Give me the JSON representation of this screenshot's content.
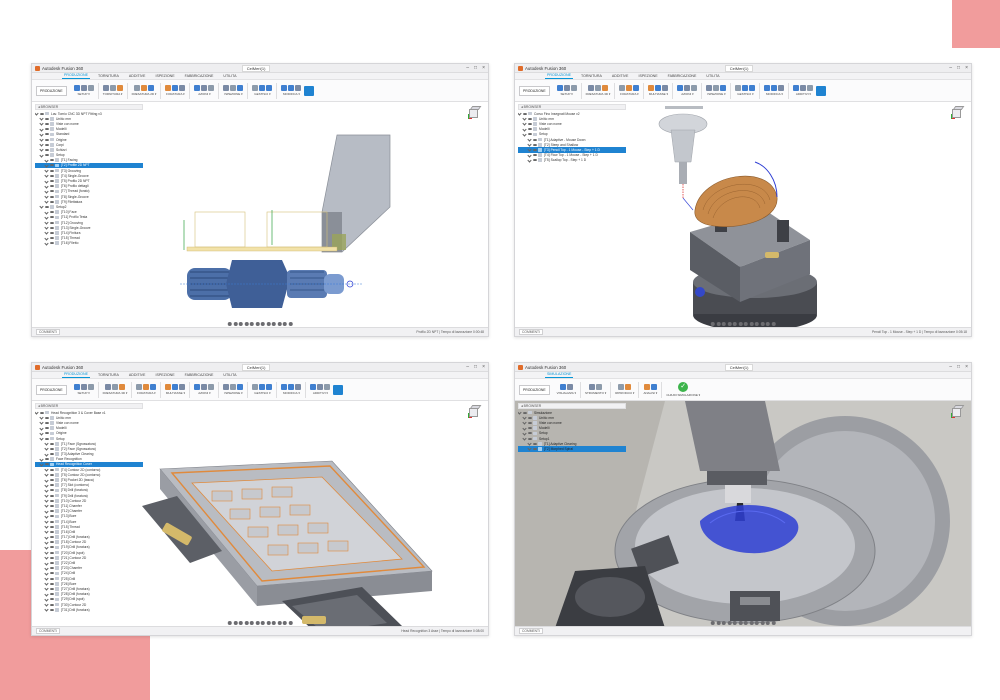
{
  "colors": {
    "accent": "#1f83d1",
    "decoration": "#f19c9c",
    "part_orange": "#e08a3c",
    "toolpath_blue": "#2e3ed4"
  },
  "windows": [
    {
      "app_title": "Autodesk Fusion 360",
      "document_tab": "CelMeri(1)",
      "tabs": [
        "PRODUZIONE",
        "TORNITURA",
        "ADDITIVE",
        "ISPEZIONE",
        "FABBRICAZIONE",
        "UTILITA"
      ],
      "workspace": "PRODUZIONE",
      "ribbon_groups": [
        "SETUP",
        "TORNITURA",
        "FRESATURA 2D",
        "FORATURA",
        "AZIONI",
        "ISPEZIONE",
        "GESTISCI",
        "MODIFICA"
      ],
      "browser_title": "BROWSER",
      "browser_items": [
        "Lav. Tornio CNC 3D NPT Fitting v3",
        "Unità: mm",
        "Viste con nome",
        "Modelli",
        "Standard",
        "Origine",
        "Corpi",
        "Schizzi",
        "Setup",
        "[T1] Facing",
        "[T2] Profile 2D NPT",
        "[T3] Grooving",
        "[T4] Single-Groove",
        "[T5] Profilo 2D NPT",
        "[T6] Profilo dettagli",
        "[T7] Thread (forato)",
        "[T8] Single-Groove",
        "[T9] Filettatura",
        "Setup2",
        "[T10] Face",
        "[T11] Profilo Testa",
        "[T12] Grooving",
        "[T13] Single-Groove",
        "[T14] Finitura",
        "[T15] Thread",
        "[T16] Filetto"
      ],
      "selected_item": 10,
      "status": "Profilo 2D NPT | Tempo di lavorazione 0:00:48",
      "comments": "COMMENTI"
    },
    {
      "app_title": "Autodesk Fusion 360",
      "document_tab": "CelMeri(1)",
      "tabs": [
        "PRODUZIONE",
        "TORNITURA",
        "ADDITIVE",
        "ISPEZIONE",
        "FABBRICAZIONE",
        "UTILITA"
      ],
      "workspace": "PRODUZIONE",
      "ribbon_groups": [
        "SETUP",
        "FRESATURA 3D",
        "FORATURA",
        "MULTIASSE",
        "AZIONI",
        "ISPEZIONE",
        "GESTISCI",
        "MODIFICA",
        "ADDITIVI"
      ],
      "browser_title": "BROWSER",
      "browser_items": [
        "Corso Fino Insegnati Mouse v2",
        "Unità: mm",
        "Viste con nome",
        "Modelli",
        "Setup",
        "[T1] Adaptive - Mouse Down",
        "[T2] Steep and Shallow",
        "[T3] Pencil Top - 1 Mouse - Step + 1 D",
        "[T4] Flow Top - 1 Mouse - Step + 1 D",
        "[T5] Scallop Top - Step + 1 D"
      ],
      "selected_item": 7,
      "status": "Pencil Top - 1 Mouse - Step + 1 D | Tempo di lavorazione 0:05:18",
      "comments": "COMMENTI"
    },
    {
      "app_title": "Autodesk Fusion 360",
      "document_tab": "CelMeri(1)",
      "tabs": [
        "PRODUZIONE",
        "TORNITURA",
        "ADDITIVE",
        "ISPEZIONE",
        "FABBRICAZIONE",
        "UTILITA"
      ],
      "workspace": "PRODUZIONE",
      "ribbon_groups": [
        "SETUP",
        "FRESATURA 3D",
        "FORATURA",
        "MULTIASSE",
        "AZIONI",
        "ISPEZIONE",
        "GESTISCI",
        "MODIFICA",
        "ADDITIVI"
      ],
      "browser_title": "BROWSER",
      "browser_items": [
        "Head Recognition 3 & Cover Base v1",
        "Unità: mm",
        "Viste con nome",
        "Modelli",
        "Origine",
        "Setup",
        "[T1] Face (Sgrossatura)",
        "[T2] Face (Sgrossatura)",
        "[T3] Adaptive Clearing",
        "Face Recognition",
        "Head Recognition Cover",
        "[T4] Contour 2D (contorno)",
        "[T5] Contour 2D (contorno)",
        "[T6] Pocket 2D (tasca)",
        "[T7] Slot (contorno)",
        "[T8] Drill (foratura)",
        "[T9] Drill (foratura)",
        "[T10] Contour 2D",
        "[T11] Chamfer",
        "[T12] Chamfer",
        "[T13] Bore",
        "[T14] Bore",
        "[T15] Thread",
        "[T16] Drill",
        "[T17] Drill (foratura)",
        "[T18] Contour 2D",
        "[T19] Drill (foratura)",
        "[T20] Drill (spot)",
        "[T21] Contour 2D",
        "[T22] Drill",
        "[T23] Chamfer",
        "[T24] Drill",
        "[T25] Drill",
        "[T26] Bore",
        "[T27] Drill (foratura)",
        "[T28] Drill (foratura)",
        "[T29] Drill (spot)",
        "[T30] Contour 2D",
        "[T31] Drill (foratura)"
      ],
      "selected_item": 10,
      "status": "Head Recognition 3 Asse | Tempo di lavorazione 0:08:00",
      "comments": "COMMENTI"
    },
    {
      "app_title": "Autodesk Fusion 360",
      "document_tab": "CelMeri(1)",
      "tabs": [
        "SIMULAZIONE"
      ],
      "workspace": "PRODUZIONE",
      "ribbon_groups": [
        "VISUALIZZA",
        "STRUMENTO",
        "RIPRODUCI",
        "ANALISI",
        "CHIUDI SIMULAZIONE"
      ],
      "browser_title": "BROWSER",
      "browser_items": [
        "Simulazione",
        "Unità: mm",
        "Viste con nome",
        "Modelli",
        "Setup",
        "Setup1",
        "[T1] Adaptive Clearing",
        "[T2] Morphed Spiral"
      ],
      "selected_item": 7,
      "status": "",
      "comments": "COMMENTI"
    }
  ]
}
